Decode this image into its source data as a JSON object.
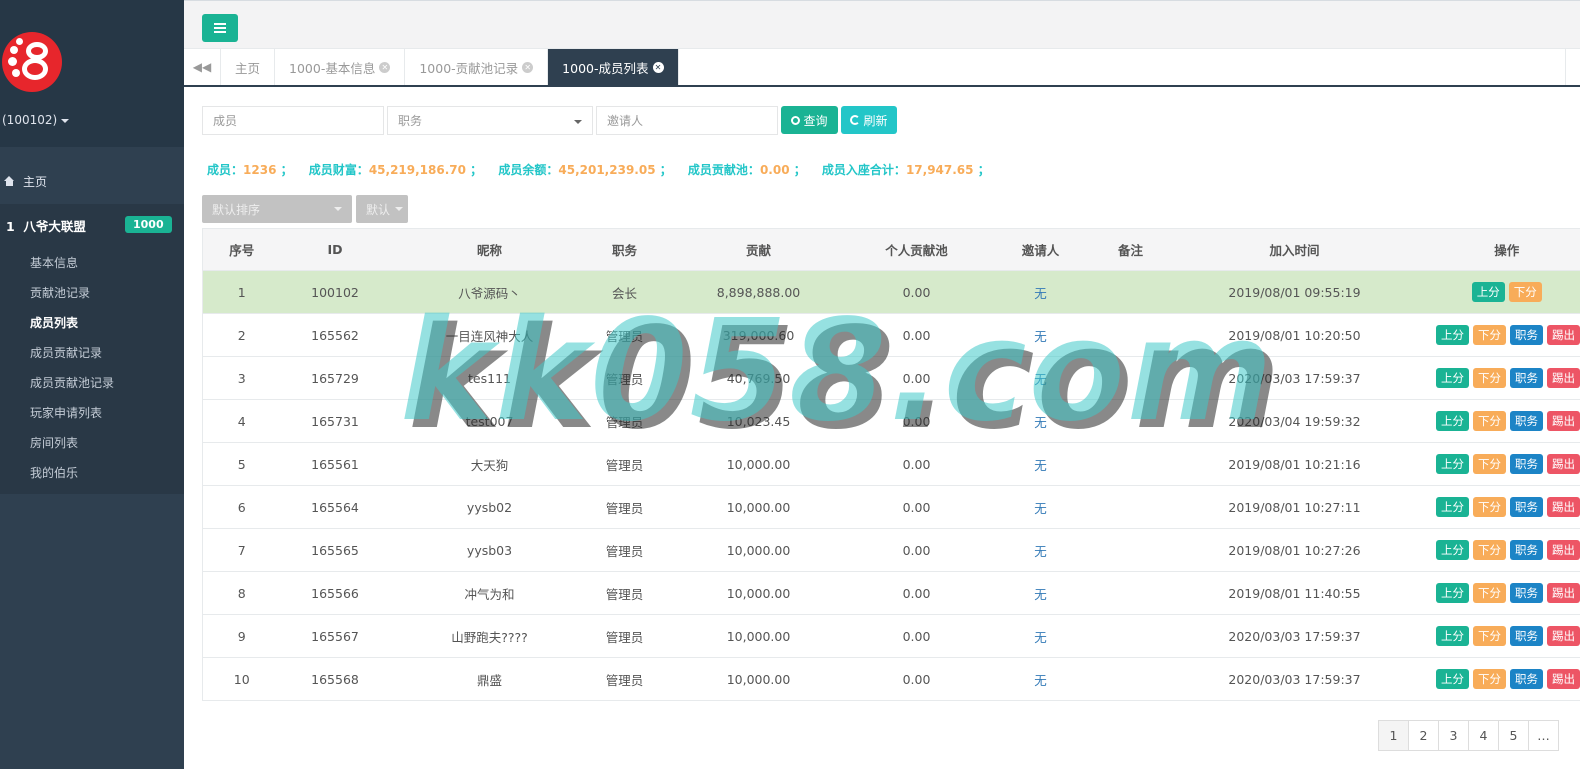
{
  "sidebar": {
    "user": "(100102)",
    "home": "主页",
    "group": {
      "index": "1",
      "title": "八爷大联盟",
      "badge": "1000"
    },
    "items": [
      "基本信息",
      "贡献池记录",
      "成员列表",
      "成员贡献记录",
      "成员贡献池记录",
      "玩家申请列表",
      "房间列表",
      "我的伯乐"
    ]
  },
  "tabs": [
    "主页",
    "1000-基本信息",
    "1000-贡献池记录",
    "1000-成员列表"
  ],
  "filters": {
    "member_placeholder": "成员",
    "role_placeholder": "职务",
    "inviter_placeholder": "邀请人",
    "query_label": "查询",
    "refresh_label": "刷新"
  },
  "stats": [
    {
      "label": "成员：",
      "value": "1236"
    },
    {
      "label": "成员财富：",
      "value": "45,219,186.70"
    },
    {
      "label": "成员余额：",
      "value": "45,201,239.05"
    },
    {
      "label": "成员贡献池：",
      "value": "0.00"
    },
    {
      "label": "成员入座合计：",
      "value": "17,947.65"
    }
  ],
  "sort": {
    "primary": "默认排序",
    "secondary": "默认"
  },
  "table": {
    "headers": [
      "序号",
      "ID",
      "昵称",
      "职务",
      "贡献",
      "个人贡献池",
      "邀请人",
      "备注",
      "加入时间",
      "操作"
    ],
    "rows": [
      [
        "1",
        "100102",
        "八爷源码丶",
        "会长",
        "8,898,888.00",
        "0.00",
        "无",
        "",
        "2019/08/01 09:55:19"
      ],
      [
        "2",
        "165562",
        "一目连风神大人",
        "管理员",
        "319,000.60",
        "0.00",
        "无",
        "",
        "2019/08/01 10:20:50"
      ],
      [
        "3",
        "165729",
        "tes111",
        "管理员",
        "40,769.50",
        "0.00",
        "无",
        "",
        "2020/03/03 17:59:37"
      ],
      [
        "4",
        "165731",
        "test007",
        "管理员",
        "10,023.45",
        "0.00",
        "无",
        "",
        "2020/03/04 19:59:32"
      ],
      [
        "5",
        "165561",
        "大天狗",
        "管理员",
        "10,000.00",
        "0.00",
        "无",
        "",
        "2019/08/01 10:21:16"
      ],
      [
        "6",
        "165564",
        "yysb02",
        "管理员",
        "10,000.00",
        "0.00",
        "无",
        "",
        "2019/08/01 10:27:11"
      ],
      [
        "7",
        "165565",
        "yysb03",
        "管理员",
        "10,000.00",
        "0.00",
        "无",
        "",
        "2019/08/01 10:27:26"
      ],
      [
        "8",
        "165566",
        "冲气为和",
        "管理员",
        "10,000.00",
        "0.00",
        "无",
        "",
        "2019/08/01 11:40:55"
      ],
      [
        "9",
        "165567",
        "山野跑夫????",
        "管理员",
        "10,000.00",
        "0.00",
        "无",
        "",
        "2020/03/03 17:59:37"
      ],
      [
        "10",
        "165568",
        "鼎盛",
        "管理员",
        "10,000.00",
        "0.00",
        "无",
        "",
        "2020/03/03 17:59:37"
      ]
    ],
    "ops": {
      "up": "上分",
      "down": "下分",
      "job": "职务",
      "kick": "踢出"
    }
  },
  "pagination": [
    "1",
    "2",
    "3",
    "4",
    "5"
  ],
  "watermark": "kk058.com",
  "colors": {
    "primary": "#1ab394",
    "info": "#23c6c8",
    "warning": "#f8ac59",
    "success_row": "#d6eacb",
    "sidebar": "#2f4050"
  }
}
